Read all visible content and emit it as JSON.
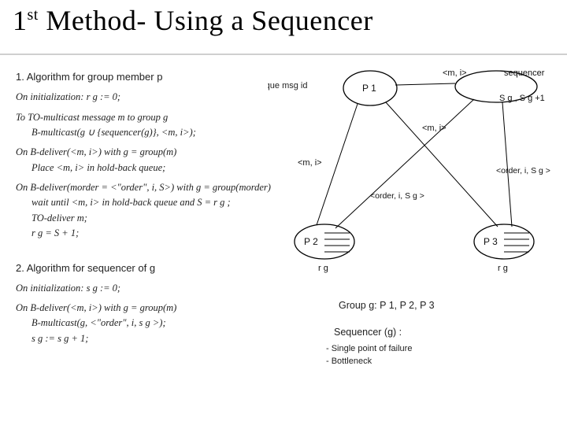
{
  "title": {
    "ord": "1",
    "sup": "st",
    "rest": " Method- Using a  Sequencer"
  },
  "algo": {
    "h1": "1. Algorithm for group member p",
    "init_lbl": "On initialization:",
    "init_val": "r g  := 0;",
    "tom_lbl": "To TO-multicast message m to group g",
    "tom_val": "B-multicast(g ∪ {sequencer(g)}, <m, i>);",
    "deliv1_lbl": "On B-deliver(<m, i>) with g = group(m)",
    "deliv1_val": "Place <m, i> in hold-back queue;",
    "deliv2_lbl": "On B-deliver(morder = <\"order\", i, S>) with g = group(morder)",
    "deliv2_l1": "wait until <m, i> in hold-back queue and S = r g ;",
    "deliv2_l2": "TO-deliver m;",
    "deliv2_l3": "r g  = S + 1;",
    "h2": "2. Algorithm for sequencer of g",
    "init2_lbl": "On initialization:",
    "init2_val": "s g  := 0;",
    "seq_lbl": "On B-deliver(<m, i>) with g = group(m)",
    "seq_l1": "B-multicast(g, <\"order\", i, s g >);",
    "seq_l2": "s g  := s g  + 1;"
  },
  "diagram": {
    "unique_label": "unique msg id",
    "p1": "P 1",
    "p2": "P 2",
    "p3": "P 3",
    "mi": "<m, i>",
    "sequencer": "sequencer",
    "sg_update": "S g  , S g +1",
    "order_center": "<order, i, S g >",
    "order_right": "<order, i, S g >",
    "rg": "r g",
    "group_line": "Group g: P 1, P 2, P 3",
    "seq_g": "Sequencer (g) :",
    "bullet1": "- Single point of failure",
    "bullet2": "- Bottleneck"
  }
}
